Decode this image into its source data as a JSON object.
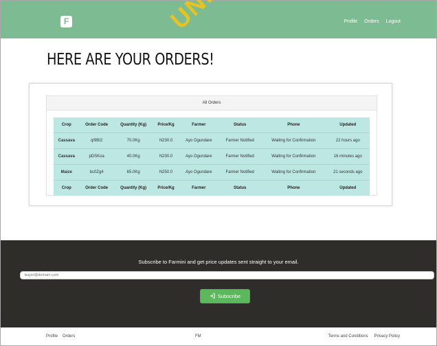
{
  "brand": {
    "logo_letter": "F"
  },
  "nav": {
    "links": [
      "Profile",
      "Orders",
      "Logout"
    ]
  },
  "watermark": "UNIV",
  "page_title": "HERE ARE YOUR ORDERS!",
  "orders_panel": {
    "title": "All Orders",
    "columns": [
      "Crop",
      "Order Code",
      "Quantity (Kg)",
      "Price/Kg",
      "Farmer",
      "Status",
      "Phone",
      "Updated"
    ],
    "rows": [
      [
        "Cassava",
        "qI9BI2",
        "70.0Kg",
        "N230.0",
        "Ayo Ogundare",
        "Farmer Notified",
        "Waiting for Confirmation",
        "22 hours ago"
      ],
      [
        "Cassava",
        "pDSKoa",
        "40.0Kg",
        "N230.0",
        "Ayo Ogundare",
        "Farmer Notified",
        "Waiting for Confirmation",
        "16 minutes ago"
      ],
      [
        "Maize",
        "bc0Zg4",
        "65.0Kg",
        "N250.0",
        "Ayo Ogundare",
        "Farmer Notified",
        "Waiting for Confirmation",
        "21 seconds ago"
      ]
    ]
  },
  "subscribe": {
    "text": "Subscribe to Farmini and get price updates sent straight to your email.",
    "email_placeholder": "buyer@domain.com",
    "button_label": "Subscribe",
    "button_icon": "sign-in-icon"
  },
  "footer": {
    "left_links": [
      "Profile",
      "Orders"
    ],
    "center_text": "FM",
    "right_links": [
      "Terms and Conditions",
      "Privacy Policy"
    ]
  },
  "colors": {
    "navbar": "#7dbb92",
    "table_bg": "#bde7e2",
    "footer_bg": "#2f2d2a",
    "button": "#5cb85c",
    "watermark": "#f6c510"
  }
}
